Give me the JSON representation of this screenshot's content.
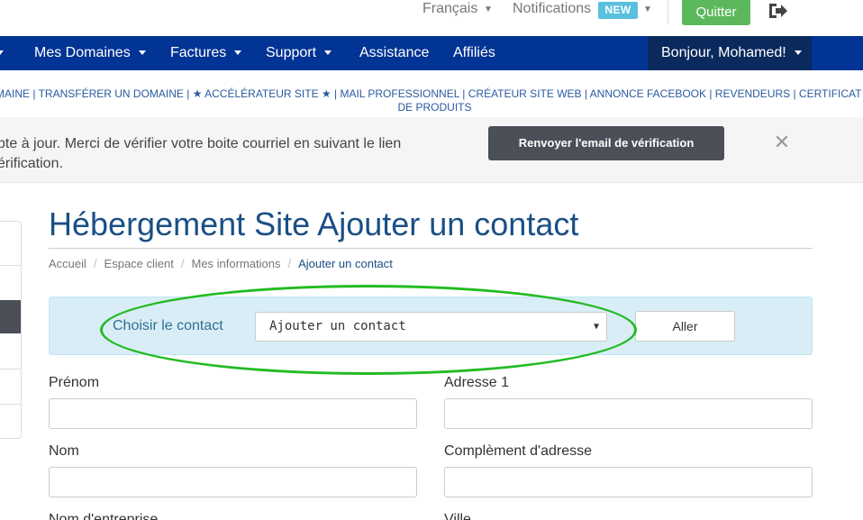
{
  "topbar": {
    "language": "Français",
    "notifications": "Notifications",
    "new_badge": "NEW",
    "quit_label": "Quitter"
  },
  "nav": {
    "items": [
      {
        "label": "Mes Domaines",
        "dropdown": true
      },
      {
        "label": "Factures",
        "dropdown": true
      },
      {
        "label": "Support",
        "dropdown": true
      },
      {
        "label": "Assistance",
        "dropdown": false
      },
      {
        "label": "Affiliés",
        "dropdown": false
      }
    ],
    "user_greeting": "Bonjour, Mohamed!"
  },
  "links": {
    "line1": "MAINE | TRANSFÉRER UN DOMAINE | ★ ACCÉLÉRATEUR SITE ★ | MAIL PROFESSIONNEL | CRÉATEUR SITE WEB | ANNONCE FACEBOOK | REVENDEURS | CERTIFICAT SSL | A",
    "line2": "DE PRODUITS"
  },
  "alert": {
    "line1": "pte à jour. Merci de vérifier votre boite courriel en suivant le lien",
    "line2": "érification.",
    "resend_label": "Renvoyer l'email de vérification",
    "close_symbol": "✕"
  },
  "page": {
    "title": "Hébergement Site Ajouter un contact",
    "breadcrumb": [
      "Accueil",
      "Espace client",
      "Mes informations",
      "Ajouter un contact"
    ]
  },
  "contact_selector": {
    "label": "Choisir le contact",
    "selected": "Ajouter un contact",
    "go_label": "Aller"
  },
  "form": {
    "first_name": "Prénom",
    "address1": "Adresse 1",
    "last_name": "Nom",
    "address2": "Complèment d'adresse",
    "company": "Nom d'entreprise",
    "city": "Ville"
  },
  "colors": {
    "nav_bg": "#013494",
    "quit_btn": "#5cb85c",
    "new_badge": "#5bc0de",
    "title": "#1a4f85",
    "annotation_ellipse": "#22bb22"
  }
}
